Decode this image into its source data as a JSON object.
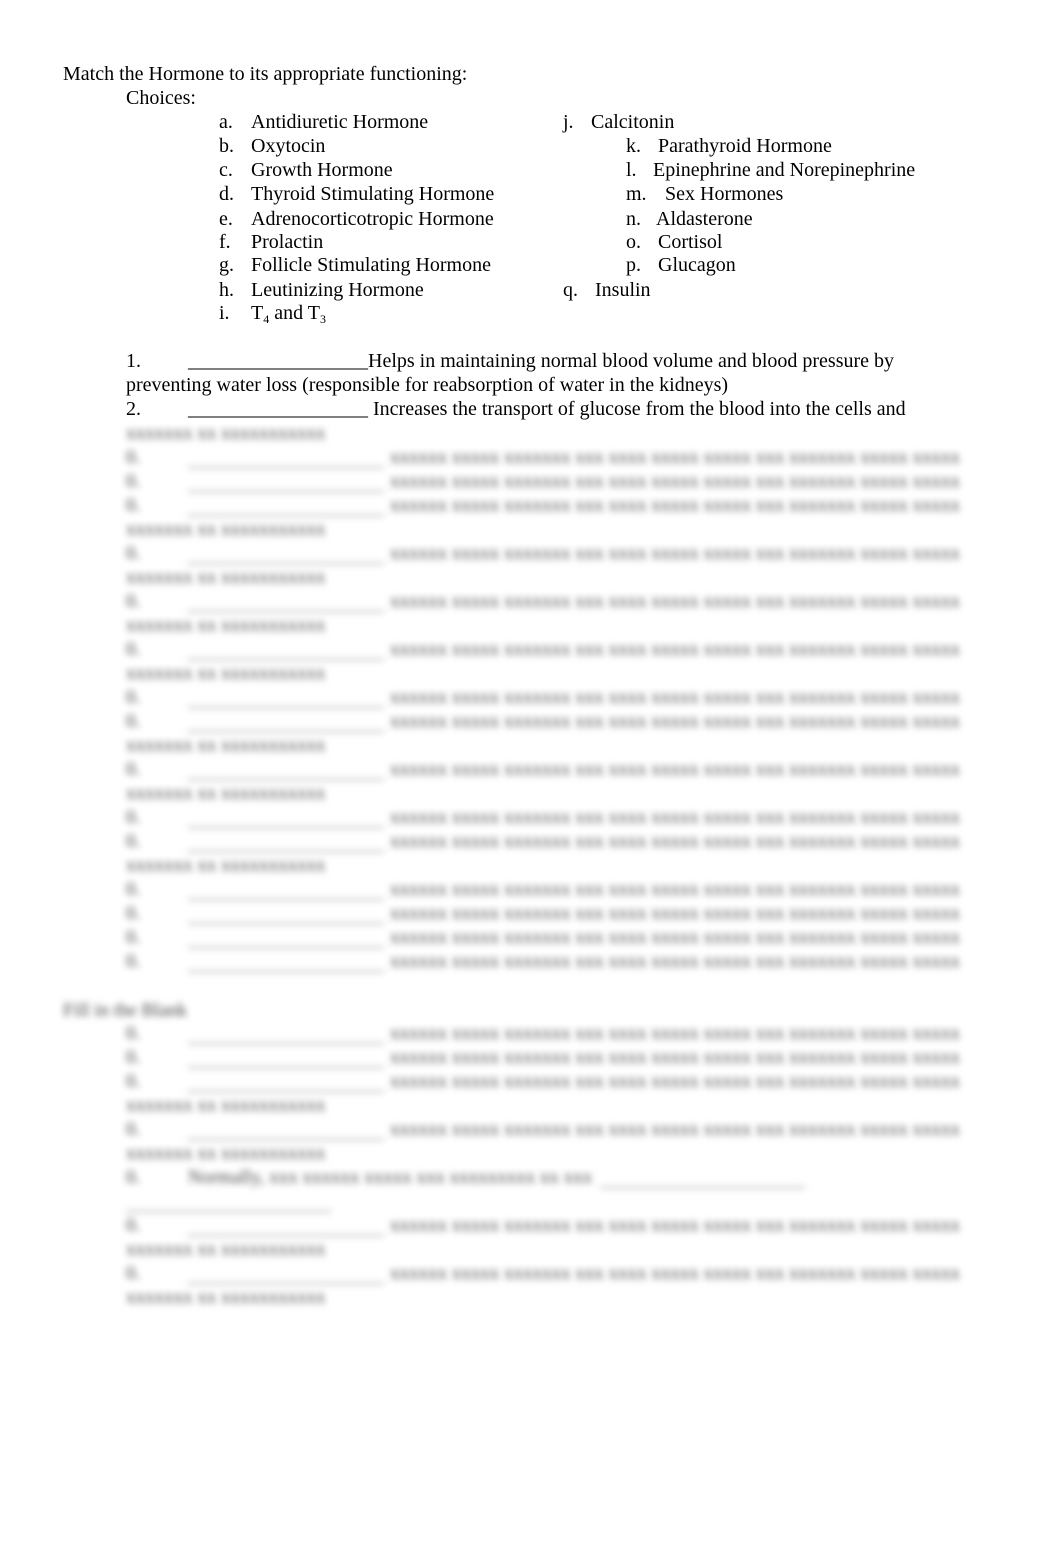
{
  "title": "Match the Hormone to its appropriate functioning:",
  "choices_label": "Choices:",
  "choices": {
    "a": {
      "letter": "a.",
      "name": "Antidiuretic Hormone"
    },
    "b": {
      "letter": "b.",
      "name": "Oxytocin"
    },
    "c": {
      "letter": "c.",
      "name": "Growth Hormone"
    },
    "d": {
      "letter": "d.",
      "name": "Thyroid Stimulating Hormone"
    },
    "e": {
      "letter": "e.",
      "name": "Adrenocorticotropic Hormone"
    },
    "f": {
      "letter": "f.",
      "name": "Prolactin"
    },
    "g": {
      "letter": "g.",
      "name": "Follicle Stimulating Hormone"
    },
    "h": {
      "letter": "h.",
      "name": "Leutinizing Hormone"
    },
    "i": {
      "letter": "i.",
      "name_part1": "T",
      "sub1": "4",
      "name_part2": " and T",
      "sub2": "3"
    },
    "j": {
      "letter": "j.",
      "name": "Calcitonin"
    },
    "k": {
      "letter": "k.",
      "name": "Parathyroid Hormone"
    },
    "l": {
      "letter": "l.",
      "name": "Epinephrine and Norepinephrine"
    },
    "m": {
      "letter": "m.",
      "name": "Sex Hormones"
    },
    "n": {
      "letter": "n.",
      "name": "Aldasterone"
    },
    "o": {
      "letter": "o.",
      "name": "Cortisol"
    },
    "p": {
      "letter": "p.",
      "name": "Glucagon"
    },
    "q": {
      "letter": "q.",
      "name": "Insulin"
    }
  },
  "questions": [
    {
      "number": "1.",
      "blank": "__________________",
      "text_line1": "Helps in maintaining normal blood volume and blood pressure by",
      "text_line2": "preventing water loss (responsible for reabsorption of water in the kidneys)"
    },
    {
      "number": "2.",
      "blank": "__________________",
      "text_line1": " Increases the transport of glucose from the blood into the cells and"
    }
  ],
  "blurred": {
    "placeholder_line": "xxxxxx xxxxx xxxxxxx xxx xxxx xxxxx xxxxx xxx xxxxxxx xxxxx xxxxx",
    "placeholder_short": "xxxxxxx xx xxxxxxxxxxx",
    "section_heading": "Fill in the Blank",
    "inline_line": "Normally, xxx xxxxxx xxxxx xxx xxxxxxxxx xx xxx"
  }
}
